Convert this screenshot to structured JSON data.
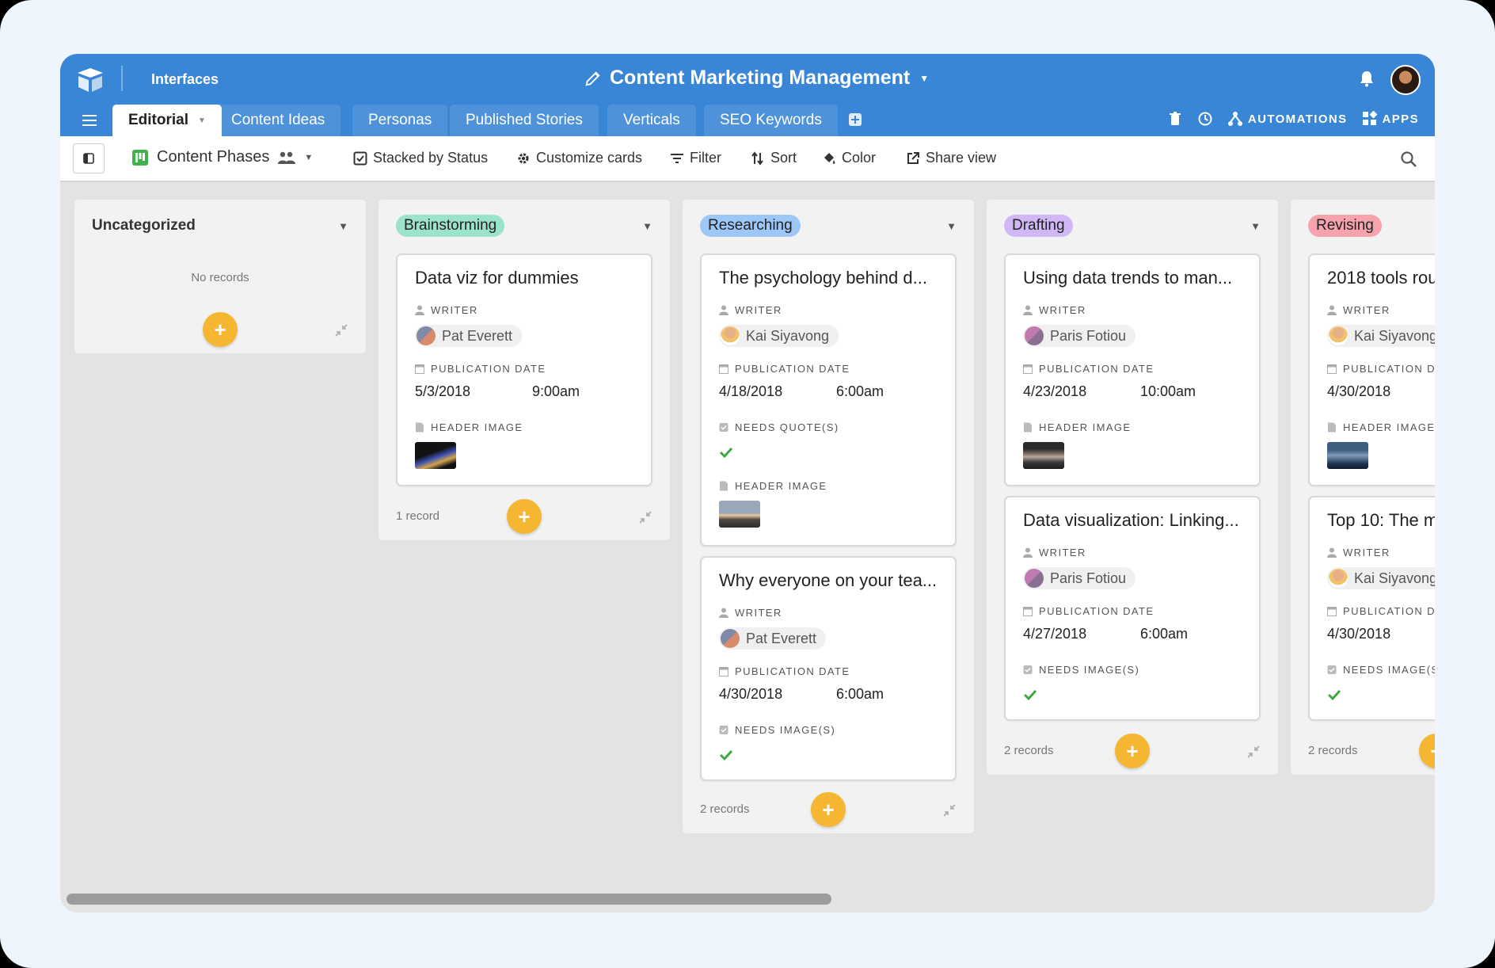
{
  "header": {
    "app_section": "Interfaces",
    "base_title": "Content Marketing Management",
    "avatar": "user-avatar"
  },
  "tabs": [
    {
      "label": "Editorial",
      "active": true
    },
    {
      "label": "Content Ideas"
    },
    {
      "label": "Personas"
    },
    {
      "label": "Published Stories"
    },
    {
      "label": "Verticals"
    },
    {
      "label": "SEO Keywords"
    }
  ],
  "right_tools": {
    "automations": "AUTOMATIONS",
    "apps": "APPS"
  },
  "toolbar": {
    "view_name": "Content Phases",
    "stacked": "Stacked by Status",
    "customize": "Customize cards",
    "filter": "Filter",
    "sort": "Sort",
    "color": "Color",
    "share": "Share view"
  },
  "labels": {
    "writer": "WRITER",
    "publication_date": "PUBLICATION DATE",
    "header_image": "HEADER IMAGE",
    "needs_quotes": "NEEDS QUOTE(S)",
    "needs_images": "NEEDS IMAGE(S)"
  },
  "colors": {
    "header_blue": "#3a86d6",
    "brainstorming": "#9be3cc",
    "researching": "#9cc7f7",
    "drafting": "#d1b8f5",
    "revising": "#f6a3ae",
    "add_button": "#f5b731",
    "check_green": "#3ea843"
  },
  "columns": [
    {
      "title": "Uncategorized",
      "empty_text": "No records",
      "count": ""
    },
    {
      "title": "Brainstorming",
      "count": "1 record",
      "cards": [
        {
          "title": "Data viz for dummies",
          "writer": "Pat Everett",
          "date": "5/3/2018",
          "time": "9:00am"
        }
      ]
    },
    {
      "title": "Researching",
      "count": "2 records",
      "cards": [
        {
          "title": "The psychology behind d...",
          "writer": "Kai Siyavong",
          "date": "4/18/2018",
          "time": "6:00am"
        },
        {
          "title": "Why everyone on your tea...",
          "writer": "Pat Everett",
          "date": "4/30/2018",
          "time": "6:00am"
        }
      ]
    },
    {
      "title": "Drafting",
      "count": "2 records",
      "cards": [
        {
          "title": "Using data trends to man...",
          "writer": "Paris Fotiou",
          "date": "4/23/2018",
          "time": "10:00am"
        },
        {
          "title": "Data visualization: Linking...",
          "writer": "Paris Fotiou",
          "date": "4/27/2018",
          "time": "6:00am"
        }
      ]
    },
    {
      "title": "Revising",
      "count": "2 records",
      "cards": [
        {
          "title": "2018 tools rou",
          "writer": "Kai Siyavong",
          "date": "4/30/2018"
        },
        {
          "title": "Top 10: The m",
          "writer": "Kai Siyavong",
          "date": "4/30/2018"
        }
      ]
    }
  ]
}
